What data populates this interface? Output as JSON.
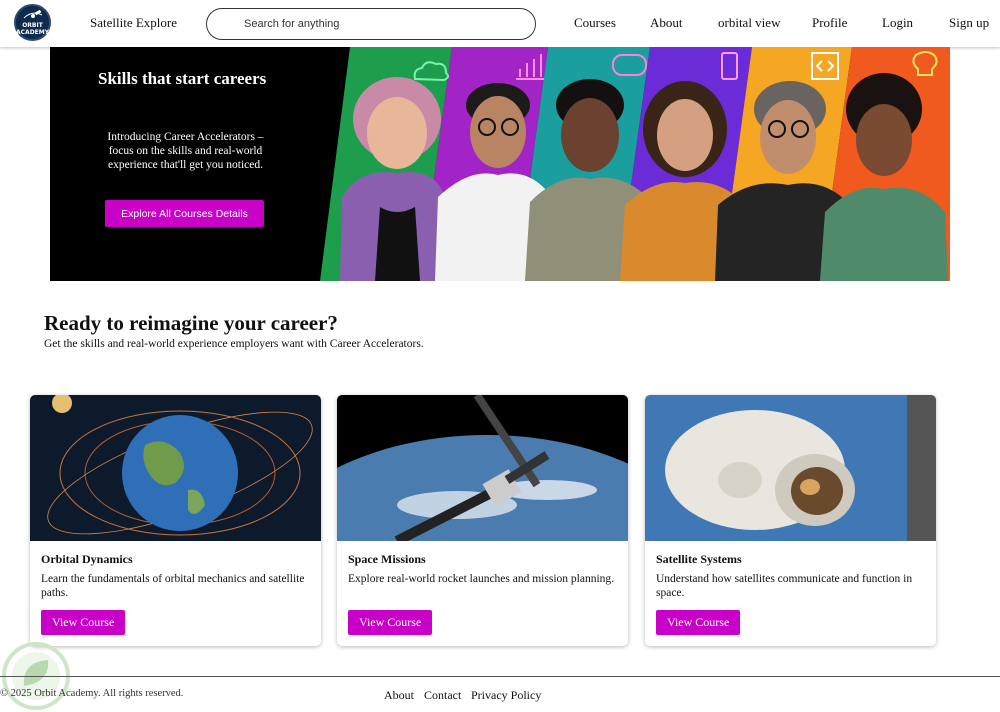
{
  "nav": {
    "logo_text": "ORBIT ACADEMY",
    "brand": "Satellite Explore",
    "search_placeholder": "Search for anything",
    "links": [
      "Courses",
      "About",
      "orbital view",
      "Profile",
      "Login",
      "Sign up"
    ]
  },
  "hero": {
    "title": "Skills that start careers",
    "text": "Introducing Career Accelerators – focus on the skills and real-world experience that'll get you noticed.",
    "button": "Explore All Courses Details",
    "band_colors": [
      "#1c9e4c",
      "#a224c6",
      "#1b9e9e",
      "#6b2bd6",
      "#f5a623",
      "#f05a1e"
    ],
    "band_icons": [
      "cloud-icon",
      "bar-chart-icon",
      "gamepad-icon",
      "phone-icon",
      "code-icon",
      "lightbulb-icon"
    ]
  },
  "section": {
    "title": "Ready to reimagine your career?",
    "subtitle": "Get the skills and real-world experience employers want with Career Accelerators."
  },
  "cards": [
    {
      "title": "Orbital Dynamics",
      "desc": "Learn the fundamentals of orbital mechanics and satellite paths.",
      "button": "View Course"
    },
    {
      "title": "Space Missions",
      "desc": "Explore real-world rocket launches and mission planning.",
      "button": "View Course"
    },
    {
      "title": "Satellite Systems",
      "desc": "Understand how satellites communicate and function in space.",
      "button": "View Course"
    }
  ],
  "footer": {
    "copyright": "© 2025 Orbit Academy. All rights reserved.",
    "links": [
      "About",
      "Contact",
      "Privacy Policy"
    ]
  },
  "colors": {
    "accent": "#c800c8",
    "hero_bg": "#000000"
  }
}
